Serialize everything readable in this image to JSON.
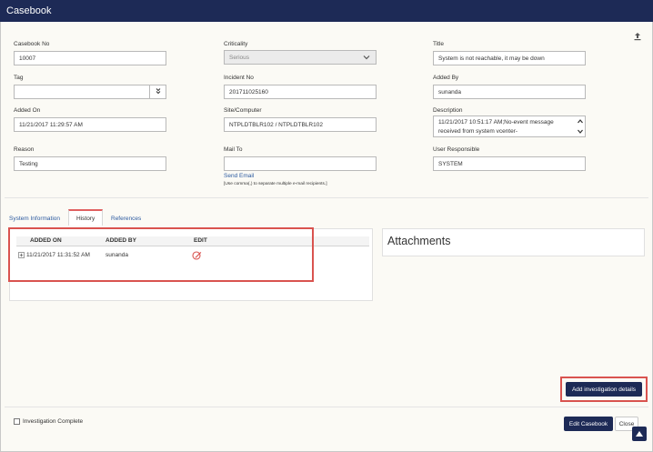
{
  "window": {
    "title": "Casebook"
  },
  "form": {
    "casebook_no": {
      "label": "Casebook No",
      "value": "10007"
    },
    "criticality": {
      "label": "Criticality",
      "value": "Serious"
    },
    "title": {
      "label": "Title",
      "value": "System is not reachable, it may be down"
    },
    "tag": {
      "label": "Tag",
      "value": ""
    },
    "incident_no": {
      "label": "Incident No",
      "value": "201711025160"
    },
    "added_by": {
      "label": "Added By",
      "value": "sunanda"
    },
    "added_on": {
      "label": "Added On",
      "value": "11/21/2017 11:29:57 AM"
    },
    "site_computer": {
      "label": "Site/Computer",
      "value": "NTPLDTBLR102 / NTPLDTBLR102"
    },
    "description": {
      "label": "Description",
      "value": "11/21/2017 10:51:17 AM;No-event message received from system vcenter-"
    },
    "reason": {
      "label": "Reason",
      "value": "Testing"
    },
    "mail_to": {
      "label": "Mail To",
      "value": "",
      "send_email": "Send Email",
      "hint": "[Use comma(,) to separate multiple e-mail recipients.]"
    },
    "user_responsible": {
      "label": "User Responsible",
      "value": "SYSTEM"
    }
  },
  "tabs": [
    {
      "label": "System Information",
      "active": false
    },
    {
      "label": "History",
      "active": true
    },
    {
      "label": "References",
      "active": false
    }
  ],
  "history": {
    "columns": [
      "ADDED ON",
      "ADDED BY",
      "EDIT"
    ],
    "rows": [
      {
        "added_on": "11/21/2017 11:31:52 AM",
        "added_by": "sunanda"
      }
    ]
  },
  "attachments": {
    "title": "Attachments"
  },
  "buttons": {
    "add_investigation": "Add investigation details",
    "edit_casebook": "Edit Casebook",
    "close": "Close"
  },
  "footer": {
    "investigation_complete": "Investigation Complete"
  },
  "colors": {
    "primary": "#1d2a56",
    "highlight": "#d9534f",
    "link": "#2c5aa0"
  }
}
